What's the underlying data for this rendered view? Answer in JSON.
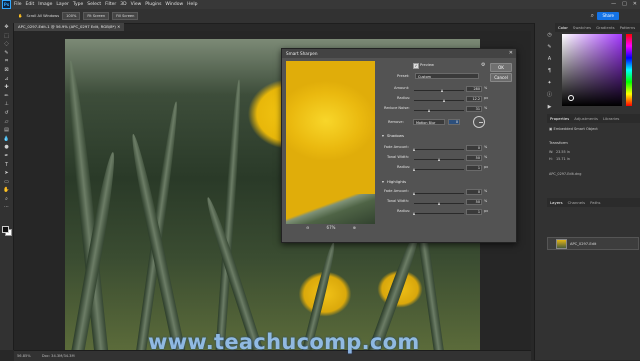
{
  "app": {
    "name": "Ps"
  },
  "menu": [
    "File",
    "Edit",
    "Image",
    "Layer",
    "Type",
    "Select",
    "Filter",
    "3D",
    "View",
    "Plugins",
    "Window",
    "Help"
  ],
  "window_controls": {
    "minimize": "—",
    "maximize": "□",
    "close": "✕"
  },
  "options_bar": {
    "scroll_all": "Scroll All Windows",
    "zoom": "100%",
    "fit_screen": "Fit Screen",
    "fill_screen": "Fill Screen",
    "share": "Share"
  },
  "document_tab": "APC_0297-Edit-1 @ 56.9% (APC_0297 Edit, RGB/8*) ✕",
  "status_bar": {
    "zoom": "56.85%",
    "doc_size": "Doc: 34.3M/34.3M"
  },
  "dialog": {
    "title": "Smart Sharpen",
    "close": "✕",
    "ok": "OK",
    "cancel": "Cancel",
    "preview_label": "Preview",
    "preview_zoom": "67%",
    "zoom_out": "⊖",
    "zoom_in": "⊕",
    "preset_label": "Preset:",
    "preset_value": "Custom",
    "amount_label": "Amount:",
    "amount_value": "280",
    "amount_unit": "%",
    "radius_label": "Radius:",
    "radius_value": "12.2",
    "radius_unit": "px",
    "noise_label": "Reduce Noise:",
    "noise_value": "31",
    "noise_unit": "%",
    "remove_label": "Remove:",
    "remove_value": "Motion Blur",
    "angle_value": "0",
    "shadows_header": "Shadows",
    "highlights_header": "Highlights",
    "fade_label": "Fade Amount:",
    "tonal_label": "Tonal Width:",
    "radius2_label": "Radius:",
    "sh_fade": "0",
    "sh_tonal": "50",
    "sh_radius": "1",
    "hl_fade": "0",
    "hl_tonal": "50",
    "hl_radius": "1",
    "pct": "%",
    "px": "px"
  },
  "sliders": {
    "amount": 0.56,
    "radius": 0.6,
    "noise": 0.31,
    "sh_fade": 0.0,
    "sh_tonal": 0.5,
    "sh_radius": 0.0,
    "hl_fade": 0.0,
    "hl_tonal": 0.5,
    "hl_radius": 0.0
  },
  "right_panel": {
    "color_tabs": [
      "Color",
      "Swatches",
      "Gradients",
      "Patterns"
    ],
    "props_tabs": [
      "Properties",
      "Adjustments",
      "Libraries"
    ],
    "smart_object": "Embedded Smart Object",
    "transform_label": "Transform",
    "w_label": "W:",
    "w_value": "23.55 in",
    "h_label": "H:",
    "h_value": "15.71 in",
    "file_name": "APC_0297-Edit.dng",
    "layers_tabs": [
      "Layers",
      "Channels",
      "Paths"
    ],
    "layer_name": "APC_0297-Edit"
  },
  "watermark": "www.teachucomp.com",
  "colors": {
    "accent": "#1473e6",
    "panel": "#323232",
    "dialog": "#535353"
  }
}
